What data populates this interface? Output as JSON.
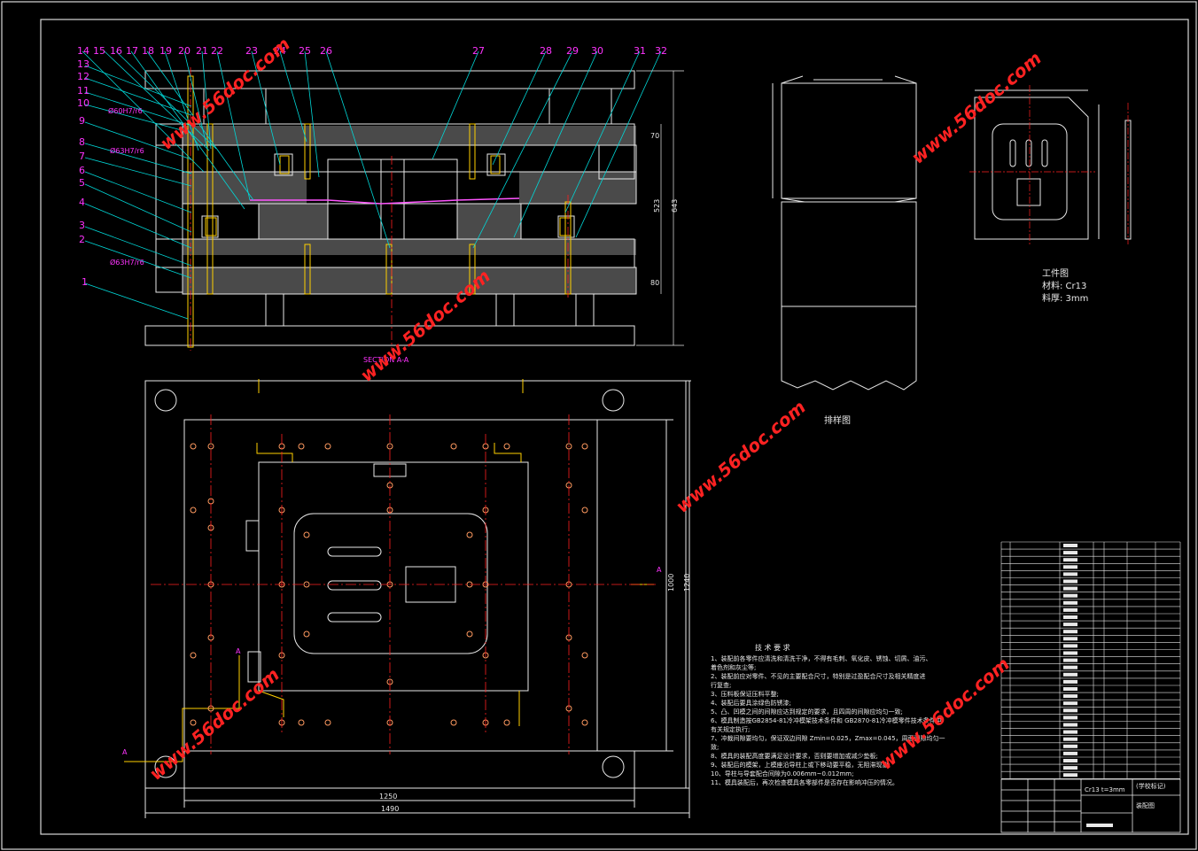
{
  "colors": {
    "background": "#000000",
    "frame": "#d8d8d8",
    "outline": "#e8e8e8",
    "centerline": "#ff2020",
    "leader": "#00d8d8",
    "label": "#ff33ff",
    "hatch": "#9a9a9a",
    "pin": "#ffd000",
    "watermark": "#ff2222"
  },
  "part_numbers": [
    "1",
    "2",
    "3",
    "4",
    "5",
    "6",
    "7",
    "8",
    "9",
    "10",
    "11",
    "12",
    "13",
    "14",
    "15",
    "16",
    "17",
    "18",
    "19",
    "20",
    "21",
    "22",
    "23",
    "24",
    "25",
    "26",
    "27",
    "28",
    "29",
    "30",
    "31",
    "32"
  ],
  "section_view": {
    "section_label": "SECTION A-A",
    "fits": [
      "Ø60H7/r6",
      "Ø63H7/r6",
      "Ø63H7/r6"
    ],
    "dims": [
      "70",
      "523",
      "643",
      "80"
    ]
  },
  "plan_view": {
    "dims": [
      "1250",
      "1490",
      "1000",
      "1240"
    ],
    "cut_marks": [
      "A",
      "A",
      "A"
    ]
  },
  "workpiece": {
    "title": "工件图",
    "material": "材料: Cr13",
    "thickness": "料厚: 3mm"
  },
  "strip_layout": {
    "title": "排样图"
  },
  "tech_requirements": {
    "title": "技 术 要 求",
    "lines": [
      "1、装配前各零件应清洗和清洗干净，不得有毛刺、氧化皮、锈蚀、切屑、油污、",
      "着色剂和灰尘等;",
      "2、装配前应对零件、不见的主要配合尺寸，特别是过盈配合尺寸及相关精度进",
      "行复查;",
      "3、压料板保证压料平整;",
      "4、装配后要具涂绿色防锈漆;",
      "5、凸、凹模之间的间隙应达到规定的要求，且四周的间隙应均匀一致;",
      "6、模具制造按GB2854-81冷冲模架技术条件和 GB2870-81冷冲模零件技术条件中",
      "有关规定执行;",
      "7、冲裁间隙要均匀，保证双边间隙 Zmin=0.025，Zmax=0.045，周面间隙均匀一",
      "致;",
      "8、模具的装配高度要满足设计要求，否则要增加或减少垫板;",
      "9、装配后的模架，上模座沿导柱上或下移动要平稳，无阻滞现象;",
      "10、导柱与导套配合间隙为0.006mm~0.012mm;",
      "11、模具装配后，再次检查模具各零部件是否存在影响冲压的情况。"
    ]
  },
  "title_block": {
    "material_note": "Cr13 t=3mm",
    "school": "(学校标记)",
    "drawing_name": "装配图"
  },
  "watermark": {
    "text": "www.56doc.com",
    "count": 7
  }
}
